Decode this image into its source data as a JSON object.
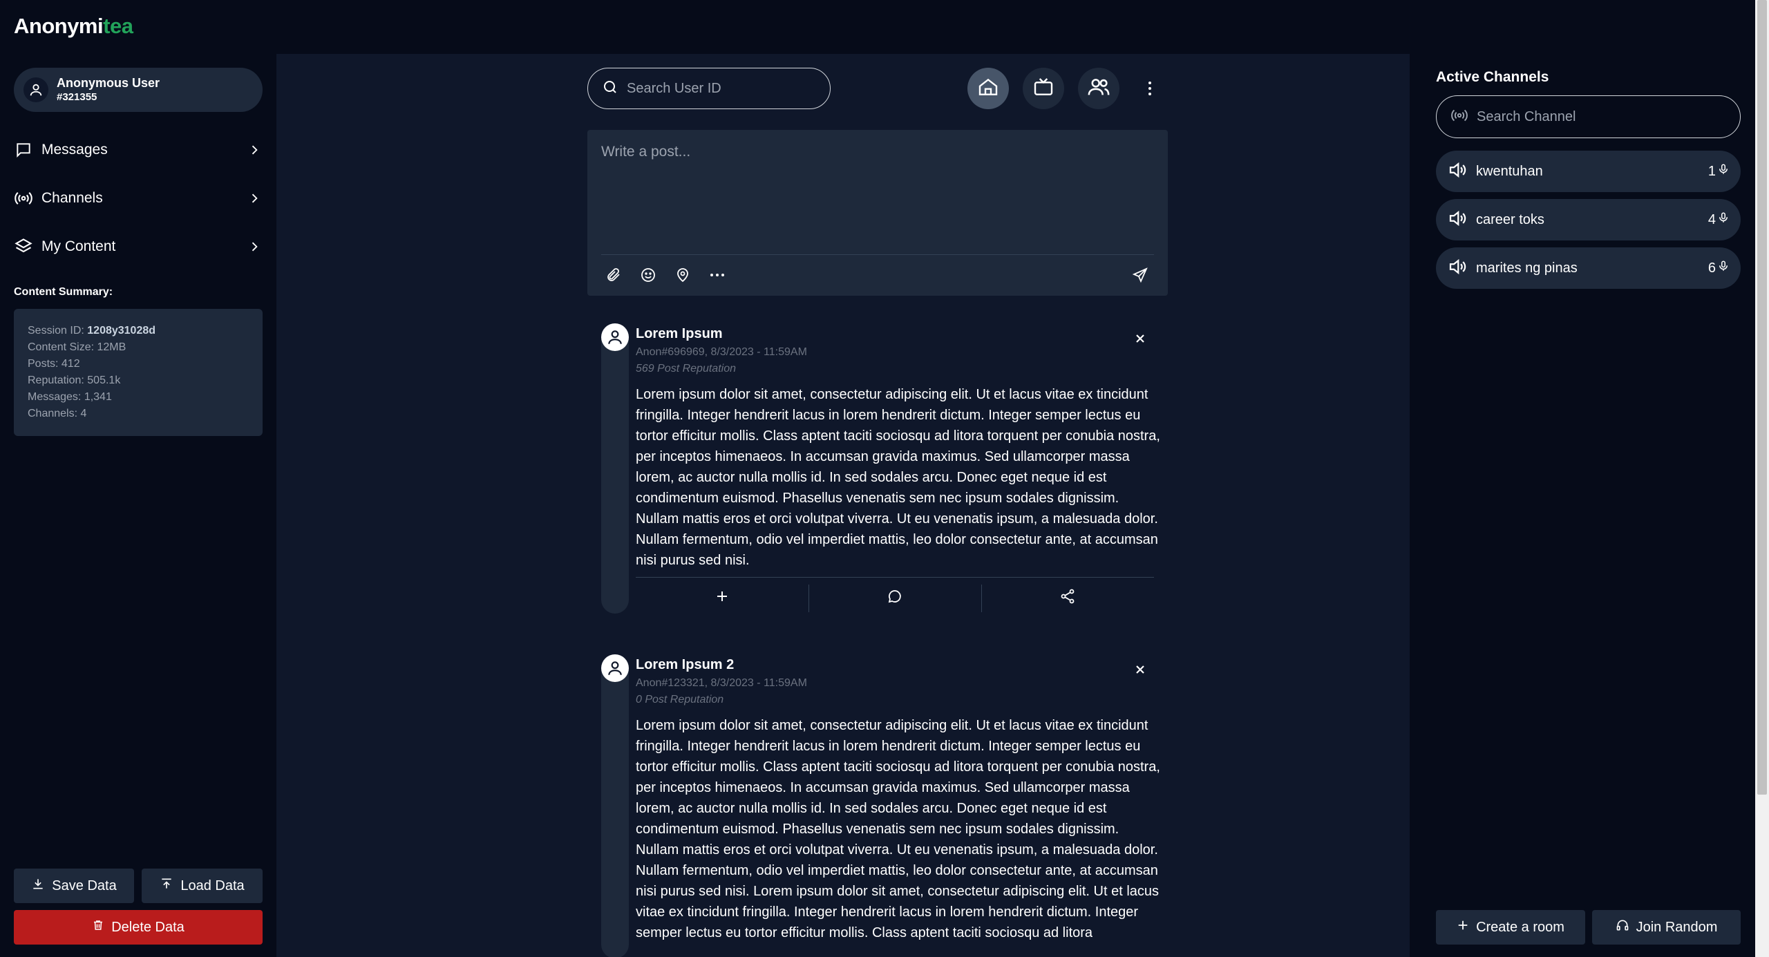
{
  "app": {
    "logo_main": "Anonymi",
    "logo_accent": "tea",
    "accent_color": "#22a35a"
  },
  "user": {
    "name": "Anonymous User",
    "id": "#321355"
  },
  "nav": [
    {
      "label": "Messages",
      "icon": "message-square-icon"
    },
    {
      "label": "Channels",
      "icon": "broadcast-icon"
    },
    {
      "label": "My Content",
      "icon": "layers-icon"
    }
  ],
  "summary": {
    "title": "Content Summary:",
    "session_label": "Session ID: ",
    "session_value": "1208y31028d",
    "content_size": "Content Size: 12MB",
    "posts": "Posts: 412",
    "reputation": "Reputation: 505.1k",
    "messages": "Messages: 1,341",
    "channels": "Channels: 4"
  },
  "actions": {
    "save": "Save Data",
    "load": "Load Data",
    "delete": "Delete Data",
    "delete_color": "#b91c1c"
  },
  "search_user": {
    "placeholder": "Search User ID"
  },
  "composer": {
    "placeholder": "Write a post..."
  },
  "posts": [
    {
      "title": "Lorem Ipsum",
      "meta": "Anon#696969, 8/3/2023 - 11:59AM",
      "reputation": "569 Post Reputation",
      "body": "Lorem ipsum dolor sit amet, consectetur adipiscing elit. Ut et lacus vitae ex tincidunt fringilla. Integer hendrerit lacus in lorem hendrerit dictum. Integer semper lectus eu tortor efficitur mollis. Class aptent taciti sociosqu ad litora torquent per conubia nostra, per inceptos himenaeos. In accumsan gravida maximus. Sed ullamcorper massa lorem, ac auctor nulla mollis id. In sed sodales arcu. Donec eget neque id est condimentum euismod. Phasellus venenatis sem nec ipsum sodales dignissim. Nullam mattis eros et orci volutpat viverra. Ut eu venenatis ipsum, a malesuada dolor. Nullam fermentum, odio vel imperdiet mattis, leo dolor consectetur ante, at accumsan nisi purus sed nisi."
    },
    {
      "title": "Lorem Ipsum 2",
      "meta": "Anon#123321, 8/3/2023 - 11:59AM",
      "reputation": "0 Post Reputation",
      "body": "Lorem ipsum dolor sit amet, consectetur adipiscing elit. Ut et lacus vitae ex tincidunt fringilla. Integer hendrerit lacus in lorem hendrerit dictum. Integer semper lectus eu tortor efficitur mollis. Class aptent taciti sociosqu ad litora torquent per conubia nostra, per inceptos himenaeos. In accumsan gravida maximus. Sed ullamcorper massa lorem, ac auctor nulla mollis id. In sed sodales arcu. Donec eget neque id est condimentum euismod. Phasellus venenatis sem nec ipsum sodales dignissim. Nullam mattis eros et orci volutpat viverra. Ut eu venenatis ipsum, a malesuada dolor. Nullam fermentum, odio vel imperdiet mattis, leo dolor consectetur ante, at accumsan nisi purus sed nisi. Lorem ipsum dolor sit amet, consectetur adipiscing elit. Ut et lacus vitae ex tincidunt fringilla. Integer hendrerit lacus in lorem hendrerit dictum. Integer semper lectus eu tortor efficitur mollis. Class aptent taciti sociosqu ad litora"
    }
  ],
  "right": {
    "title": "Active Channels",
    "search_placeholder": "Search Channel",
    "channels": [
      {
        "name": "kwentuhan",
        "count": "1"
      },
      {
        "name": "career toks",
        "count": "4"
      },
      {
        "name": "marites ng pinas",
        "count": "6"
      }
    ],
    "create": "Create a room",
    "join": "Join Random"
  }
}
